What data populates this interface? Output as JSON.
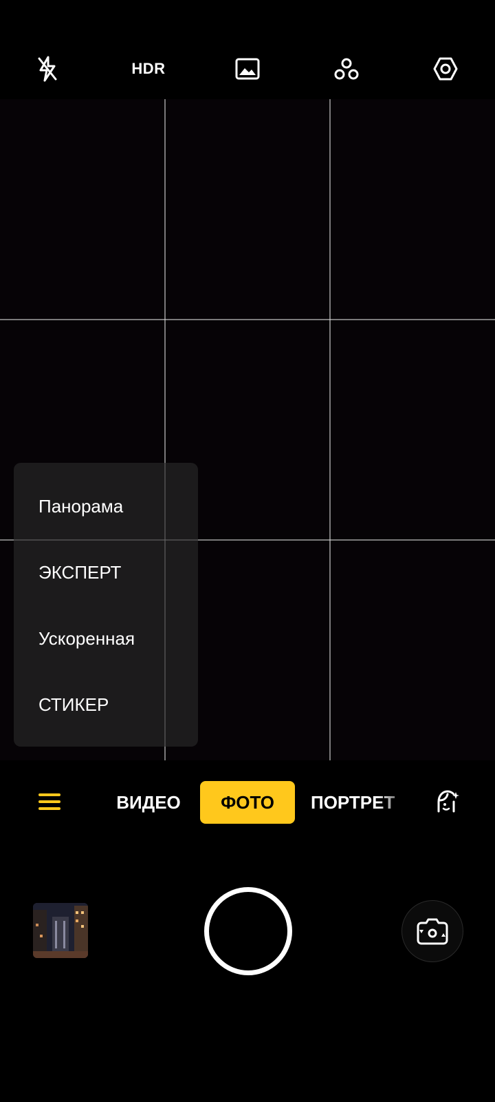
{
  "top_bar": {
    "flash_icon": "flash-off-icon",
    "hdr_label": "HDR",
    "filter_icon": "image-filter-icon",
    "effects_icon": "effects-icon",
    "settings_icon": "settings-icon"
  },
  "viewfinder": {
    "grid": "3x3"
  },
  "mode_menu": {
    "items": [
      "Панорама",
      "ЭКСПЕРТ",
      "Ускоренная",
      "СТИКЕР"
    ]
  },
  "mode_bar": {
    "menu_icon": "hamburger-menu-icon",
    "tabs": [
      "ВИДЕО",
      "ФОТО",
      "ПОРТРЕТ"
    ],
    "active_tab": "ФОТО",
    "beauty_icon": "beauty-face-icon",
    "accent_color": "#ffc81c"
  },
  "controls": {
    "gallery_thumbnail": "gallery-thumbnail",
    "shutter": "shutter-button",
    "switch_camera_icon": "switch-camera-icon"
  }
}
